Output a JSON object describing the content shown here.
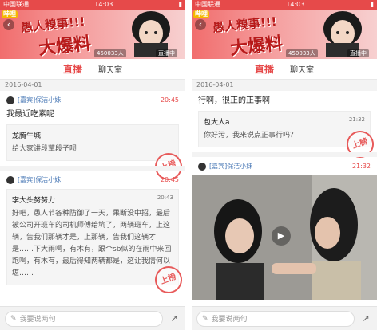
{
  "status": {
    "carrier": "中国联通",
    "time": "14:03"
  },
  "banner": {
    "logo": "哔哩",
    "title_line1": "愚人糗事!!!",
    "title_line2": "大爆料",
    "viewer_count": "450033人",
    "room_text": "直播中"
  },
  "tabs": {
    "live": "直播",
    "chat": "聊天室"
  },
  "left": {
    "date": "2016-04-01",
    "post1": {
      "author": "[嘉宾]保洁小妹",
      "time": "20:45",
      "text": "我最近吃素呢",
      "quote_name": "龙腾牛城",
      "quote_text": "给大家讲段荤段子呗"
    },
    "post2": {
      "author": "[嘉宾]保洁小妹",
      "time": "20:45",
      "quote_name": "李大头努努力",
      "quote_time": "20:43",
      "quote_text": "好吧，愚人节各种防御了一天，果断没中招，最后被公司开班车的司机师傅给坑了，两辆班车，上这辆，告我们那辆才是，上那辆，告我们这辆才是……下大雨啊，有木有，跟个sb似的在雨中来回跑啊，有木有，最后得知两辆都是，这让我情何以堪……"
    },
    "stamp": "上榜",
    "input_placeholder": "我要说两句"
  },
  "right": {
    "date": "2016-04-01",
    "top_text": "行啊，很正的正事啊",
    "quote_name": "包大人a",
    "quote_time": "21:32",
    "quote_text": "你好污，我来说点正事行吗？",
    "post_author": "[嘉宾]保洁小妹",
    "post_time": "21:32",
    "stamp": "上榜",
    "input_placeholder": "我要说两句"
  },
  "colors": {
    "accent": "#e64a4a",
    "link": "#4a79b6"
  }
}
